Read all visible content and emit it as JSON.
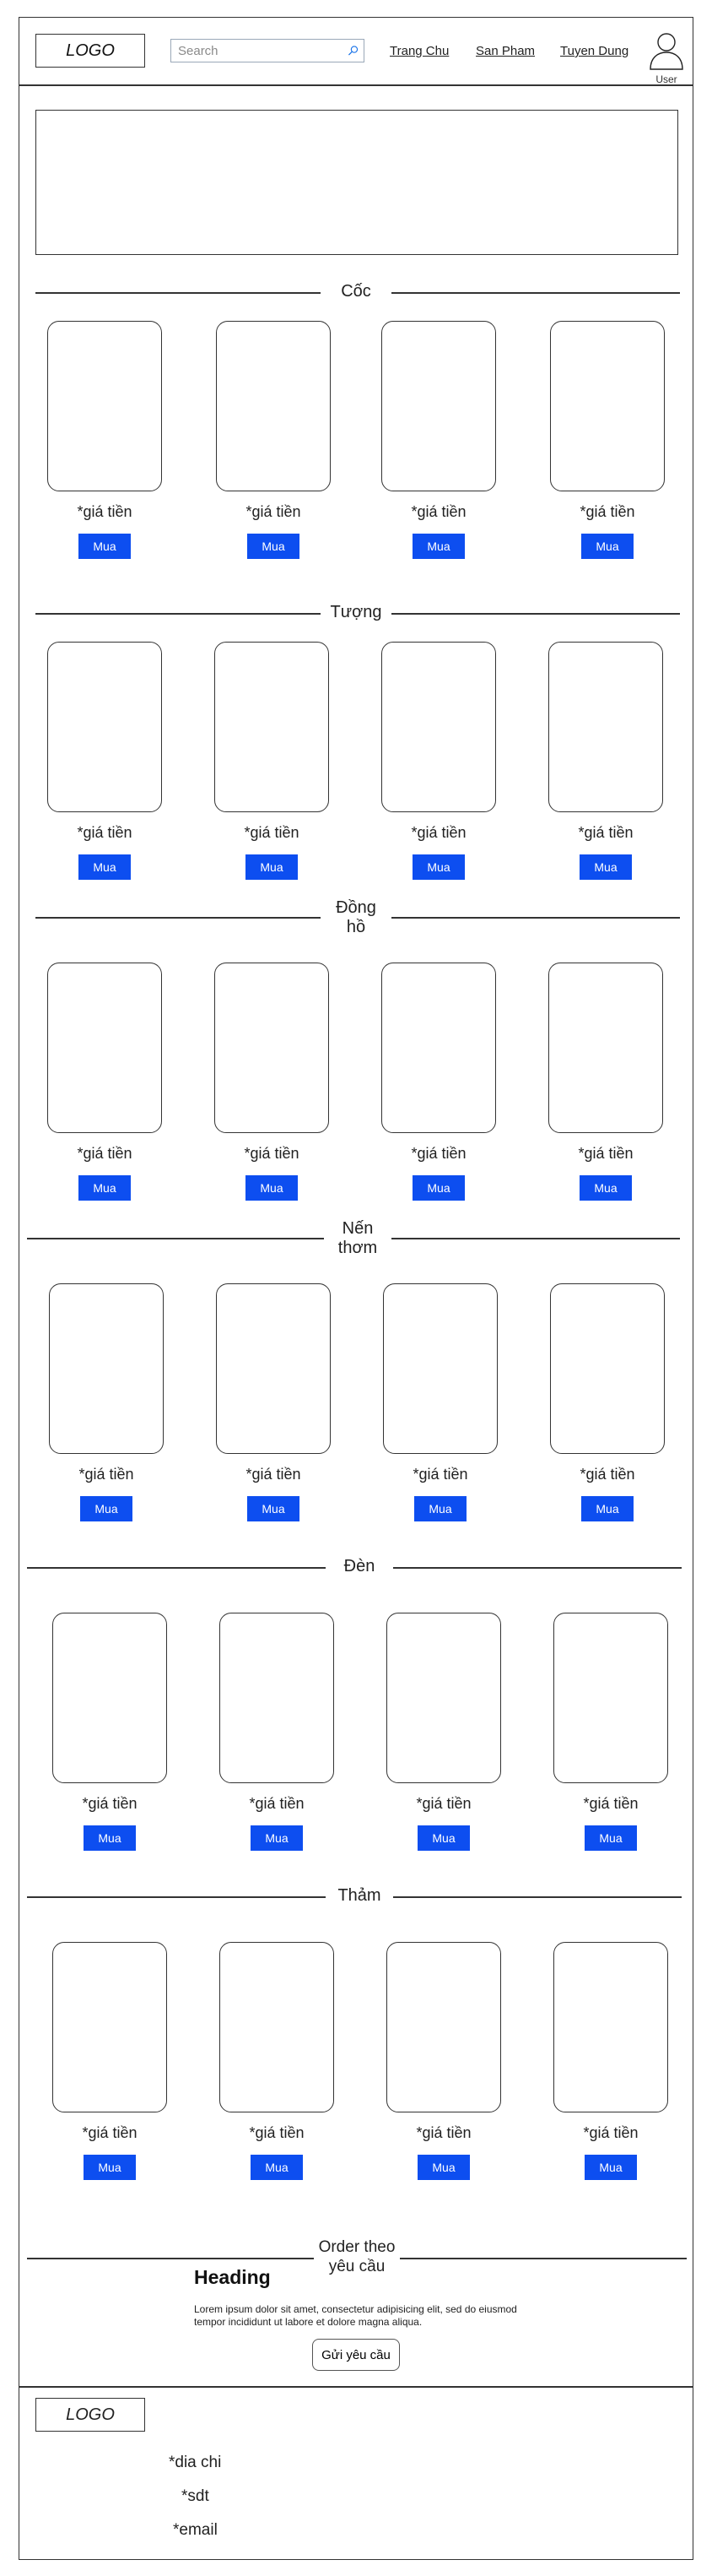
{
  "header": {
    "logo": "LOGO",
    "search_placeholder": "Search",
    "nav": [
      "Trang Chu",
      "San Pham",
      "Tuyen Dung"
    ],
    "user_label": "User"
  },
  "sections": [
    {
      "title": [
        "Cốc"
      ],
      "products": [
        {
          "price": "*giá tiền",
          "buy": "Mua"
        },
        {
          "price": "*giá tiền",
          "buy": "Mua"
        },
        {
          "price": "*giá tiền",
          "buy": "Mua"
        },
        {
          "price": "*giá tiền",
          "buy": "Mua"
        }
      ]
    },
    {
      "title": [
        "Tượng"
      ],
      "products": [
        {
          "price": "*giá tiền",
          "buy": "Mua"
        },
        {
          "price": "*giá tiền",
          "buy": "Mua"
        },
        {
          "price": "*giá tiền",
          "buy": "Mua"
        },
        {
          "price": "*giá tiền",
          "buy": "Mua"
        }
      ]
    },
    {
      "title": [
        "Đồng",
        "hồ"
      ],
      "products": [
        {
          "price": "*giá tiền",
          "buy": "Mua"
        },
        {
          "price": "*giá tiền",
          "buy": "Mua"
        },
        {
          "price": "*giá tiền",
          "buy": "Mua"
        },
        {
          "price": "*giá tiền",
          "buy": "Mua"
        }
      ]
    },
    {
      "title": [
        "Nến",
        "thơm"
      ],
      "products": [
        {
          "price": "*giá tiền",
          "buy": "Mua"
        },
        {
          "price": "*giá tiền",
          "buy": "Mua"
        },
        {
          "price": "*giá tiền",
          "buy": "Mua"
        },
        {
          "price": "*giá tiền",
          "buy": "Mua"
        }
      ]
    },
    {
      "title": [
        "Đèn"
      ],
      "products": [
        {
          "price": "*giá tiền",
          "buy": "Mua"
        },
        {
          "price": "*giá tiền",
          "buy": "Mua"
        },
        {
          "price": "*giá tiền",
          "buy": "Mua"
        },
        {
          "price": "*giá tiền",
          "buy": "Mua"
        }
      ]
    },
    {
      "title": [
        "Thảm"
      ],
      "products": [
        {
          "price": "*giá tiền",
          "buy": "Mua"
        },
        {
          "price": "*giá tiền",
          "buy": "Mua"
        },
        {
          "price": "*giá tiền",
          "buy": "Mua"
        },
        {
          "price": "*giá tiền",
          "buy": "Mua"
        }
      ]
    }
  ],
  "order": {
    "title": [
      "Order theo",
      "yêu cầu"
    ],
    "heading": "Heading",
    "text": "Lorem ipsum dolor sit amet, consectetur adipisicing elit, sed do eiusmod tempor incididunt ut labore et dolore magna aliqua.",
    "button": "Gửi yêu cầu"
  },
  "footer": {
    "logo": "LOGO",
    "address": "*dia chi",
    "phone": "*sdt",
    "email": "*email"
  },
  "colors": {
    "accent": "#0d4ef0",
    "border": "#333333"
  }
}
